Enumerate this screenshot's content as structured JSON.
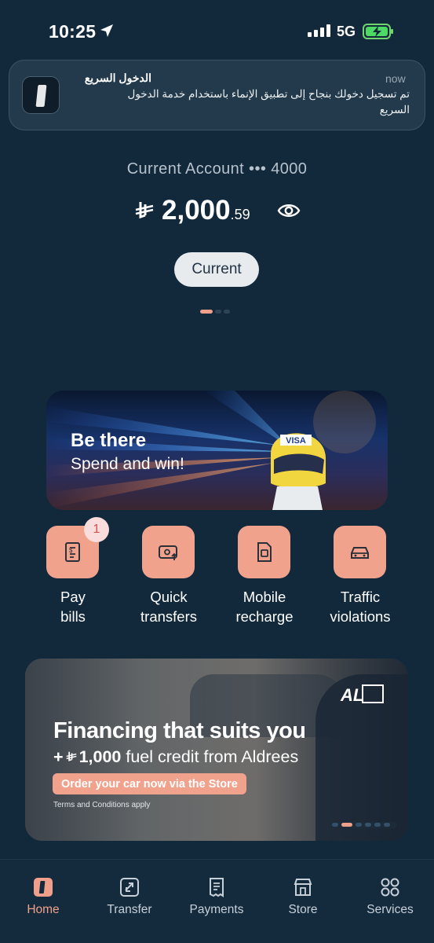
{
  "status_bar": {
    "time": "10:25",
    "network": "5G"
  },
  "notification": {
    "app_title": "الدخول السريع",
    "time": "now",
    "body": "تم تسجيل دخولك بنجاح إلى تطبيق الإنماء باستخدام خدمة الدخول السريع"
  },
  "account": {
    "name": "Current Account ••• 4000",
    "currency_symbol": "⃁",
    "balance_main": "2,000",
    "balance_decimal": ".59",
    "type_pill": "Current"
  },
  "banner_promo": {
    "line1": "Be there",
    "line2": "Spend and win!",
    "helmet_text": "VISA"
  },
  "actions": [
    {
      "label_line1": "Pay",
      "label_line2": "bills",
      "icon": "bill-icon",
      "badge": "1"
    },
    {
      "label_line1": "Quick",
      "label_line2": "transfers",
      "icon": "quick-transfer-icon"
    },
    {
      "label_line1": "Mobile",
      "label_line2": "recharge",
      "icon": "sim-card-icon"
    },
    {
      "label_line1": "Traffic",
      "label_line2": "violations",
      "icon": "car-icon"
    }
  ],
  "banner_finance": {
    "title": "Financing that suits you",
    "sub_prefix": "+",
    "sub_amount": "1,000",
    "sub_rest": " fuel credit from Aldrees",
    "cta": "Order your car now via the Store",
    "terms": "Terms and Conditions apply",
    "logo_text": "AL"
  },
  "tabs": [
    {
      "label": "Home",
      "icon": "home-icon",
      "active": true
    },
    {
      "label": "Transfer",
      "icon": "transfer-icon"
    },
    {
      "label": "Payments",
      "icon": "receipt-icon"
    },
    {
      "label": "Store",
      "icon": "store-icon"
    },
    {
      "label": "Services",
      "icon": "grid-icon"
    }
  ],
  "colors": {
    "background": "#12283b",
    "accent": "#f0a08a",
    "pill": "#e7ebee"
  }
}
